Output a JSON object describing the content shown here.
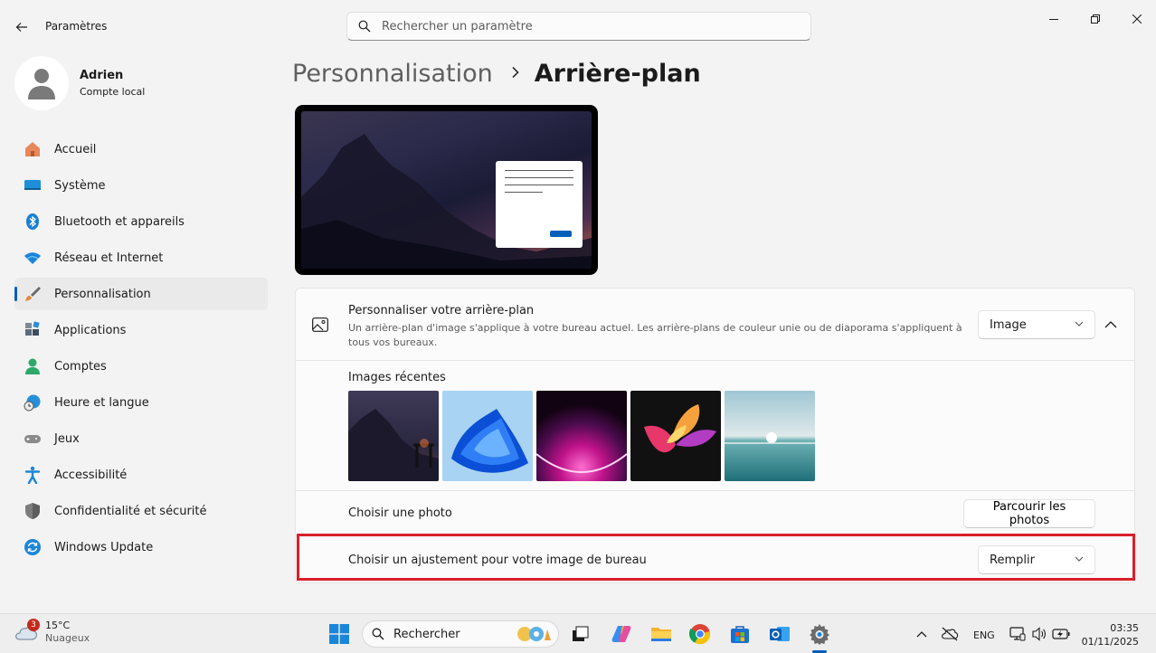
{
  "app": {
    "title": "Paramètres"
  },
  "search": {
    "placeholder": "Rechercher un paramètre"
  },
  "profile": {
    "name": "Adrien",
    "account_type": "Compte local"
  },
  "sidebar": {
    "items": [
      {
        "label": "Accueil",
        "icon": "home-icon"
      },
      {
        "label": "Système",
        "icon": "system-icon"
      },
      {
        "label": "Bluetooth et appareils",
        "icon": "bluetooth-icon"
      },
      {
        "label": "Réseau et Internet",
        "icon": "wifi-icon"
      },
      {
        "label": "Personnalisation",
        "icon": "brush-icon",
        "active": true
      },
      {
        "label": "Applications",
        "icon": "apps-icon"
      },
      {
        "label": "Comptes",
        "icon": "accounts-icon"
      },
      {
        "label": "Heure et langue",
        "icon": "clock-globe-icon"
      },
      {
        "label": "Jeux",
        "icon": "gamepad-icon"
      },
      {
        "label": "Accessibilité",
        "icon": "accessibility-icon"
      },
      {
        "label": "Confidentialité et sécurité",
        "icon": "shield-icon"
      },
      {
        "label": "Windows Update",
        "icon": "update-icon"
      }
    ]
  },
  "breadcrumb": {
    "parent": "Personnalisation",
    "separator": ">",
    "current": "Arrière-plan"
  },
  "background": {
    "title": "Personnaliser votre arrière-plan",
    "description": "Un arrière-plan d'image s'applique à votre bureau actuel. Les arrière-plans de couleur unie ou de diaporama s'appliquent à tous vos bureaux.",
    "type_value": "Image",
    "recent_title": "Images récentes",
    "choose_photo_label": "Choisir une photo",
    "browse_button": "Parcourir les photos",
    "fit_label": "Choisir un ajustement pour votre image de bureau",
    "fit_value": "Remplir"
  },
  "taskbar": {
    "weather": {
      "temp": "15°C",
      "condition": "Nuageux",
      "badge": "3"
    },
    "search_label": "Rechercher",
    "language": "ENG",
    "time": "03:35",
    "date": "01/11/2025"
  },
  "colors": {
    "accent": "#005fb8",
    "highlight": "#d91f2a"
  }
}
